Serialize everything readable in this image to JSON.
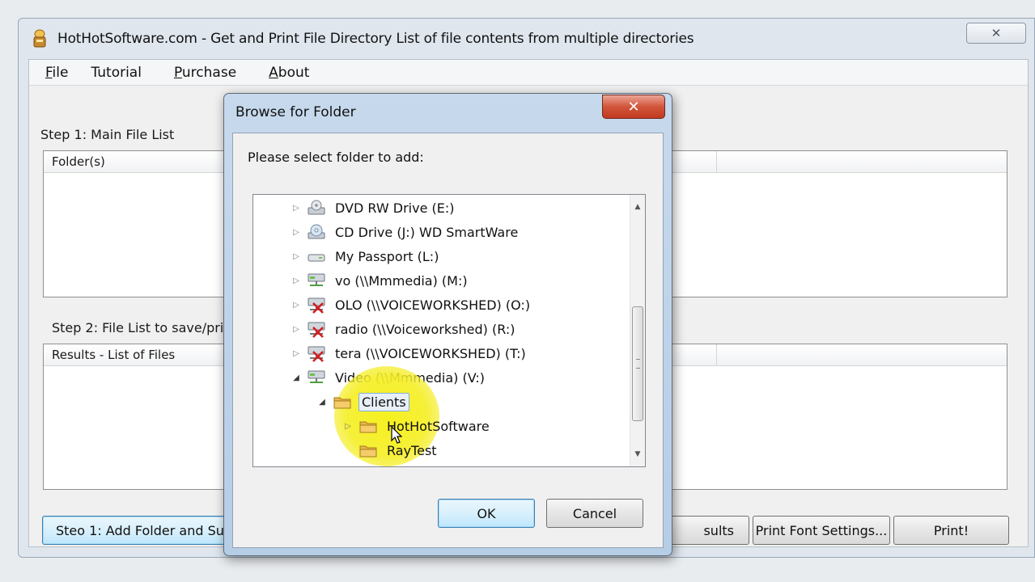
{
  "window": {
    "title": "HotHotSoftware.com - Get and Print File Directory List of file contents from multiple directories",
    "close_glyph": "✕"
  },
  "menu": {
    "items": [
      {
        "first": "F",
        "rest": "ile"
      },
      {
        "first": "",
        "rest": "Tutorial"
      },
      {
        "first": "P",
        "rest": "urchase"
      },
      {
        "first": "A",
        "rest": "bout"
      }
    ]
  },
  "step1": {
    "label": "Step 1: Main File List",
    "column_header": "Folder(s)"
  },
  "step2": {
    "label": "Step 2: File List to save/pri",
    "column_header": "Results - List of Files"
  },
  "buttons": {
    "add_folder": "Steo 1: Add Folder and Su",
    "results": "sults",
    "print_font": "Print Font Settings...",
    "print": "Print!"
  },
  "dialog": {
    "title": "Browse for Folder",
    "close_glyph": "✕",
    "prompt": "Please select folder to add:",
    "ok": "OK",
    "cancel": "Cancel",
    "tree": [
      {
        "label": "DVD RW Drive (E:)",
        "icon": "optical-drive-icon"
      },
      {
        "label": "CD Drive (J:) WD SmartWare",
        "icon": "cd-drive-icon"
      },
      {
        "label": "My Passport (L:)",
        "icon": "removable-drive-icon"
      },
      {
        "label": "vo (\\\\Mmmedia) (M:)",
        "icon": "network-drive-icon"
      },
      {
        "label": "OLO (\\\\VOICEWORKSHED) (O:)",
        "icon": "disconnected-network-drive-icon"
      },
      {
        "label": "radio (\\\\Voiceworkshed) (R:)",
        "icon": "disconnected-network-drive-icon"
      },
      {
        "label": "tera (\\\\VOICEWORKSHED) (T:)",
        "icon": "disconnected-network-drive-icon"
      },
      {
        "label": "Video (\\\\Mmmedia) (V:)",
        "icon": "network-drive-icon"
      },
      {
        "label": "Clients",
        "icon": "folder-icon"
      },
      {
        "label": "HotHotSoftware",
        "icon": "folder-icon"
      },
      {
        "label": "RayTest",
        "icon": "folder-icon"
      }
    ]
  }
}
